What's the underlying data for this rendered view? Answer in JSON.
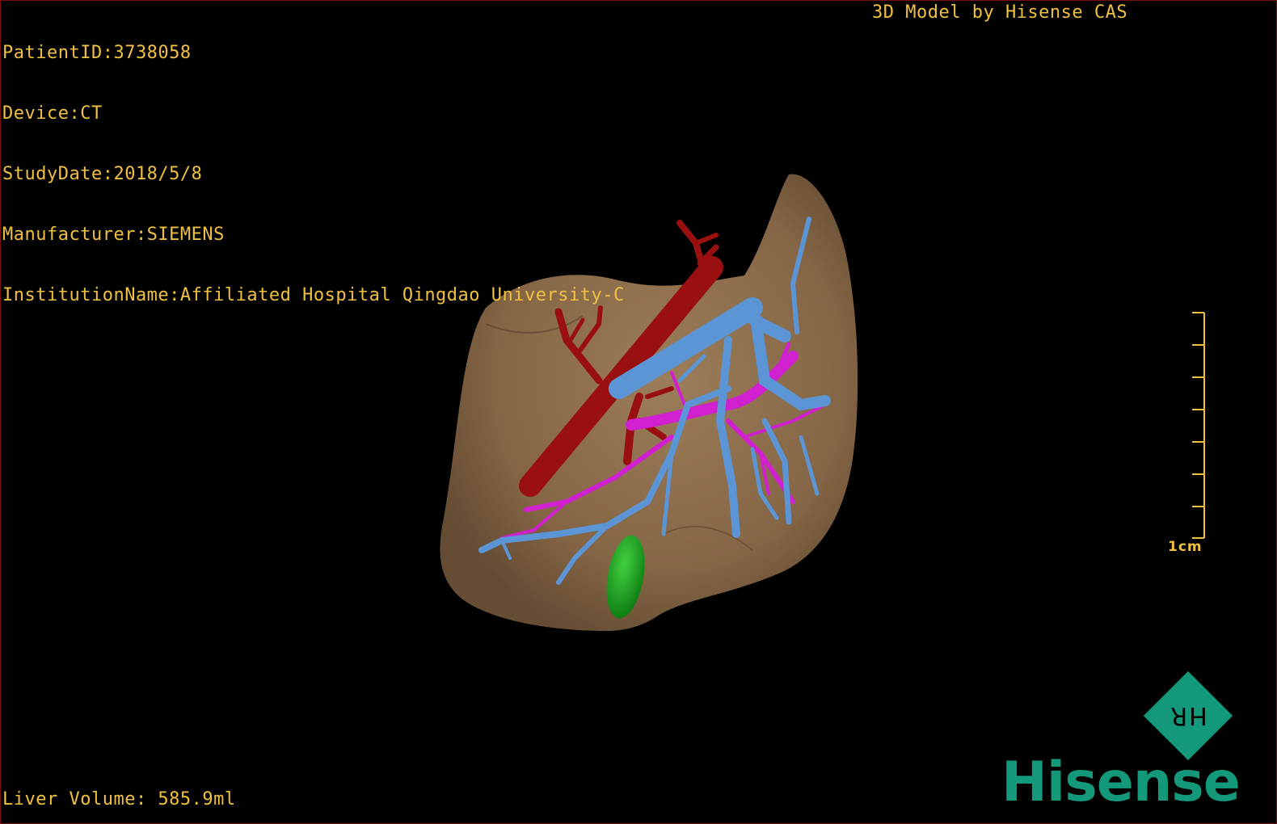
{
  "header": {
    "patient_id": "PatientID:3738058",
    "device": "Device:CT",
    "study_date": "StudyDate:2018/5/8",
    "manufacturer": "Manufacturer:SIEMENS",
    "institution": "InstitutionName:Affiliated Hospital Qingdao University-C",
    "model_credit": "3D Model by Hisense CAS"
  },
  "footer": {
    "liver_volume": "Liver Volume: 585.9ml"
  },
  "scale_bar": {
    "label": "1cm"
  },
  "logo": {
    "word": "Hisense",
    "mark_text": "HR"
  },
  "colors": {
    "overlay_text": "#f0c040",
    "liver": "#8c6a48",
    "artery": "#9a1010",
    "portal_vein": "#5b95d6",
    "hepatic_vein": "#d020d0",
    "gallbladder": "#18a018",
    "brand": "#14987a"
  }
}
